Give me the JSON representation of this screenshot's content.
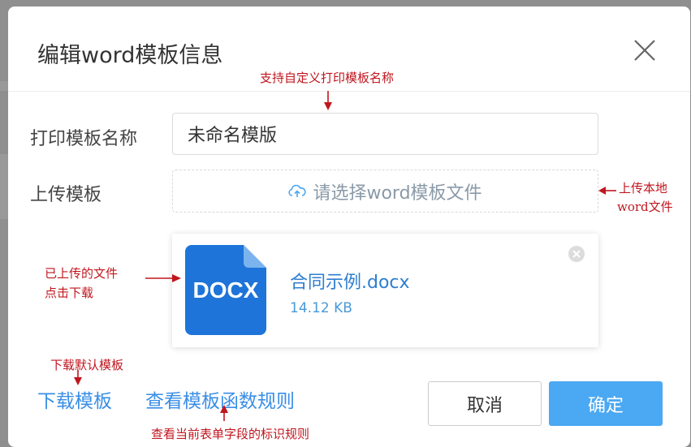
{
  "dialog": {
    "title": "编辑word模板信息"
  },
  "form": {
    "name_label": "打印模板名称",
    "name_value": "未命名模版",
    "upload_label": "上传模板",
    "upload_placeholder": "请选择word模板文件"
  },
  "file": {
    "icon_text": "DOCX",
    "name": "合同示例.docx",
    "size": "14.12 KB"
  },
  "footer": {
    "download_link": "下载模板",
    "rules_link": "查看模板函数规则",
    "cancel_label": "取消",
    "ok_label": "确定"
  },
  "annotations": {
    "custom_name": "支持自定义打印模板名称",
    "upload_local_line1": "上传本地",
    "upload_local_line2": "word文件",
    "uploaded_line1": "已上传的文件",
    "uploaded_line2": "点击下载",
    "download_default": "下载默认模板",
    "field_rules": "查看当前表单字段的标识规则"
  },
  "colors": {
    "primary": "#4ba8f2",
    "link": "#3a8ee6",
    "annotation": "#c0161e",
    "doc_icon": "#1e74d9"
  }
}
